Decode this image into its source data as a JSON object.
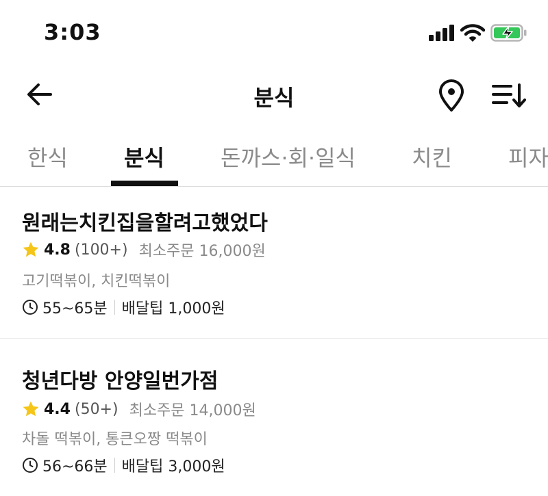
{
  "status_bar": {
    "time": "3:03"
  },
  "header": {
    "title": "분식"
  },
  "tabs": [
    {
      "label": "한식",
      "active": false
    },
    {
      "label": "분식",
      "active": true
    },
    {
      "label": "돈까스·회·일식",
      "active": false
    },
    {
      "label": "치킨",
      "active": false
    },
    {
      "label": "피자",
      "active": false
    }
  ],
  "stores": [
    {
      "name": "원래는치킨집을할려고했었다",
      "rating": "4.8",
      "reviews": "(100+)",
      "min_order": "최소주문 16,000원",
      "menu": "고기떡볶이, 치킨떡볶이",
      "delivery_time": "55~65분",
      "delivery_fee": "배달팁 1,000원"
    },
    {
      "name": "청년다방 안양일번가점",
      "rating": "4.4",
      "reviews": "(50+)",
      "min_order": "최소주문 14,000원",
      "menu": "차돌 떡볶이, 통큰오짱 떡볶이",
      "delivery_time": "56~66분",
      "delivery_fee": "배달팁 3,000원"
    }
  ],
  "colors": {
    "star": "#f5c518",
    "battery_fill": "#34c759",
    "active_tab": "#111111",
    "inactive_tab": "#8a8a8a"
  },
  "icons": [
    "back-arrow-icon",
    "location-pin-icon",
    "sort-icon",
    "star-icon",
    "clock-icon",
    "signal-icon",
    "wifi-icon",
    "battery-icon"
  ]
}
